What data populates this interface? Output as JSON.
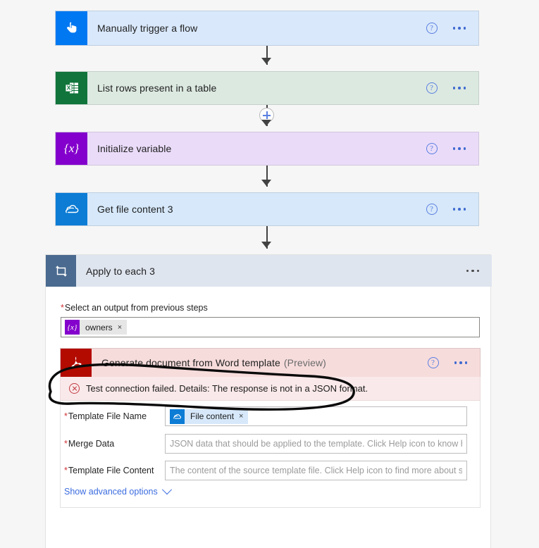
{
  "flow": {
    "steps": [
      {
        "title": "Manually trigger a flow",
        "suffix": "",
        "icon": "tap-hand-icon",
        "icon_bg": "#0078f2",
        "card_bg": "#d9e8fb",
        "has_help": true,
        "has_menu": true
      },
      {
        "title": "List rows present in a table",
        "suffix": "",
        "icon": "excel-icon",
        "icon_bg": "#11743b",
        "card_bg": "#dce9e1",
        "has_help": true,
        "has_menu": true
      },
      {
        "title": "Initialize variable",
        "suffix": "",
        "icon": "variable-braces-icon",
        "icon_bg": "#8400cc",
        "card_bg": "#eadcf9",
        "has_help": true,
        "has_menu": true
      },
      {
        "title": "Get file content 3",
        "suffix": "",
        "icon": "onedrive-cloud-icon",
        "icon_bg": "#0c7cd5",
        "card_bg": "#d6e8fa",
        "has_help": true,
        "has_menu": true
      }
    ],
    "insert_button_label": "+"
  },
  "scope": {
    "title": "Apply to each 3",
    "icon": "loop-repeat-icon",
    "icon_bg": "#4a6a8f",
    "header_bg": "#dfe5ef",
    "field": {
      "required_mark": "*",
      "label": "Select an output from previous steps",
      "token": {
        "icon_glyph": "{x}",
        "icon_bg": "#8400cc",
        "label": "owners",
        "remove": "×"
      }
    }
  },
  "action": {
    "title": "Generate document from Word template",
    "suffix": "(Preview)",
    "icon": "adobe-acrobat-icon",
    "icon_bg": "#b30b00",
    "card_bg": "#f7dcdc",
    "error": {
      "icon": "error-circle-x-icon",
      "message": "Test connection failed. Details: The response is not in a JSON format.",
      "bg": "#fae9ea",
      "accent": "#c23b43"
    },
    "fields": [
      {
        "required_mark": "*",
        "label": "Template File Name",
        "value_type": "token",
        "token": {
          "icon": "onedrive-cloud-icon",
          "icon_bg": "#0c7cd5",
          "label": "File content",
          "remove": "×",
          "chip_bg": "#d6e8fa"
        },
        "placeholder": ""
      },
      {
        "required_mark": "*",
        "label": "Merge Data",
        "value_type": "text",
        "placeholder": "JSON data that should be applied to the template. Click Help icon to know how"
      },
      {
        "required_mark": "*",
        "label": "Template File Content",
        "value_type": "text",
        "placeholder": "The content of the source template file. Click Help icon to find more about sam"
      }
    ],
    "advanced_options_label": "Show advanced options"
  },
  "annotation": {
    "type": "hand-drawn-ellipse",
    "color": "#000000",
    "target": "error-banner"
  }
}
